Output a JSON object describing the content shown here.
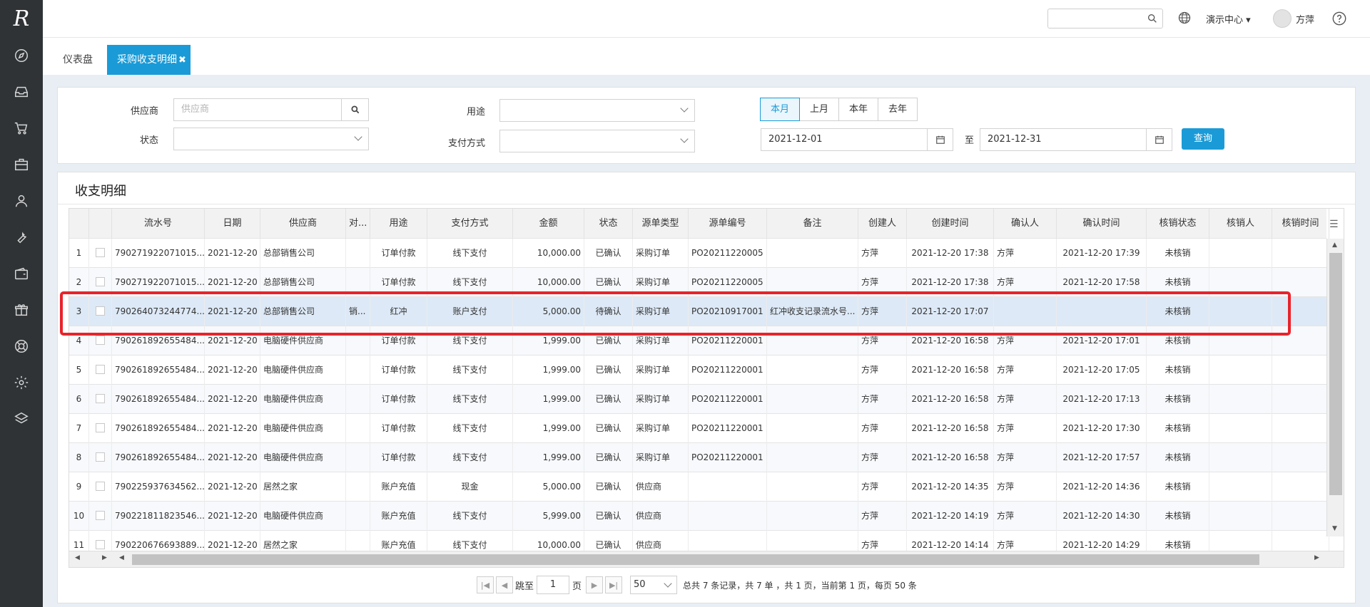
{
  "sidebar": {
    "logo": "R",
    "icons": [
      "compass-icon",
      "inbox-icon",
      "cart-icon",
      "briefcase-icon",
      "user-icon",
      "wrench-icon",
      "wallet-icon",
      "gift-icon",
      "lifebuoy-icon",
      "gear-icon",
      "layers-icon"
    ]
  },
  "topbar": {
    "search_placeholder": "",
    "demo_center": "演示中心",
    "user_name": "方萍"
  },
  "tabs": [
    {
      "label": "仪表盘"
    },
    {
      "label": "采购收支明细",
      "active": true
    }
  ],
  "filter": {
    "supplier_label": "供应商",
    "supplier_placeholder": "供应商",
    "status_label": "状态",
    "status_value": "",
    "purpose_label": "用途",
    "purpose_value": "",
    "pay_method_label": "支付方式",
    "pay_method_value": "",
    "periods": [
      "本月",
      "上月",
      "本年",
      "去年"
    ],
    "active_period": "本月",
    "date_from": "2021-12-01",
    "to_label": "至",
    "date_to": "2021-12-31",
    "query_label": "查询"
  },
  "grid": {
    "title": "收支明细",
    "columns": [
      "流水号",
      "日期",
      "供应商",
      "对...",
      "用途",
      "支付方式",
      "金额",
      "状态",
      "源单类型",
      "源单编号",
      "备注",
      "创建人",
      "创建时间",
      "确认人",
      "确认时间",
      "核销状态",
      "核销人",
      "核销时间"
    ],
    "rows": [
      {
        "no": "1",
        "serial": "790271922071015...",
        "date": "2021-12-20",
        "supplier": "总部销售公司",
        "counter": "",
        "purpose": "订单付款",
        "pay": "线下支付",
        "amount": "10,000.00",
        "status": "已确认",
        "src_type": "采购订单",
        "src_no": "PO20211220005",
        "remark": "",
        "creator": "方萍",
        "created": "2021-12-20 17:38",
        "confirmer": "方萍",
        "confirmed": "2021-12-20 17:39",
        "wo_status": "未核销"
      },
      {
        "no": "2",
        "serial": "790271922071015...",
        "date": "2021-12-20",
        "supplier": "总部销售公司",
        "counter": "",
        "purpose": "订单付款",
        "pay": "线下支付",
        "amount": "10,000.00",
        "status": "已确认",
        "src_type": "采购订单",
        "src_no": "PO20211220005",
        "remark": "",
        "creator": "方萍",
        "created": "2021-12-20 17:38",
        "confirmer": "方萍",
        "confirmed": "2021-12-20 17:58",
        "wo_status": "未核销"
      },
      {
        "no": "3",
        "serial": "790264073244774...",
        "date": "2021-12-20",
        "supplier": "总部销售公司",
        "counter": "销...",
        "purpose": "红冲",
        "pay": "账户支付",
        "amount": "5,000.00",
        "status": "待确认",
        "src_type": "采购订单",
        "src_no": "PO20210917001",
        "remark": "红冲收支记录流水号...",
        "creator": "方萍",
        "created": "2021-12-20 17:07",
        "confirmer": "",
        "confirmed": "",
        "wo_status": "未核销"
      },
      {
        "no": "4",
        "serial": "790261892655484...",
        "date": "2021-12-20",
        "supplier": "电脑硬件供应商",
        "counter": "",
        "purpose": "订单付款",
        "pay": "线下支付",
        "amount": "1,999.00",
        "status": "已确认",
        "src_type": "采购订单",
        "src_no": "PO20211220001",
        "remark": "",
        "creator": "方萍",
        "created": "2021-12-20 16:58",
        "confirmer": "方萍",
        "confirmed": "2021-12-20 17:01",
        "wo_status": "未核销"
      },
      {
        "no": "5",
        "serial": "790261892655484...",
        "date": "2021-12-20",
        "supplier": "电脑硬件供应商",
        "counter": "",
        "purpose": "订单付款",
        "pay": "线下支付",
        "amount": "1,999.00",
        "status": "已确认",
        "src_type": "采购订单",
        "src_no": "PO20211220001",
        "remark": "",
        "creator": "方萍",
        "created": "2021-12-20 16:58",
        "confirmer": "方萍",
        "confirmed": "2021-12-20 17:05",
        "wo_status": "未核销"
      },
      {
        "no": "6",
        "serial": "790261892655484...",
        "date": "2021-12-20",
        "supplier": "电脑硬件供应商",
        "counter": "",
        "purpose": "订单付款",
        "pay": "线下支付",
        "amount": "1,999.00",
        "status": "已确认",
        "src_type": "采购订单",
        "src_no": "PO20211220001",
        "remark": "",
        "creator": "方萍",
        "created": "2021-12-20 16:58",
        "confirmer": "方萍",
        "confirmed": "2021-12-20 17:13",
        "wo_status": "未核销"
      },
      {
        "no": "7",
        "serial": "790261892655484...",
        "date": "2021-12-20",
        "supplier": "电脑硬件供应商",
        "counter": "",
        "purpose": "订单付款",
        "pay": "线下支付",
        "amount": "1,999.00",
        "status": "已确认",
        "src_type": "采购订单",
        "src_no": "PO20211220001",
        "remark": "",
        "creator": "方萍",
        "created": "2021-12-20 16:58",
        "confirmer": "方萍",
        "confirmed": "2021-12-20 17:30",
        "wo_status": "未核销"
      },
      {
        "no": "8",
        "serial": "790261892655484...",
        "date": "2021-12-20",
        "supplier": "电脑硬件供应商",
        "counter": "",
        "purpose": "订单付款",
        "pay": "线下支付",
        "amount": "1,999.00",
        "status": "已确认",
        "src_type": "采购订单",
        "src_no": "PO20211220001",
        "remark": "",
        "creator": "方萍",
        "created": "2021-12-20 16:58",
        "confirmer": "方萍",
        "confirmed": "2021-12-20 17:57",
        "wo_status": "未核销"
      },
      {
        "no": "9",
        "serial": "790225937634562...",
        "date": "2021-12-20",
        "supplier": "居然之家",
        "counter": "",
        "purpose": "账户充值",
        "pay": "现金",
        "amount": "5,000.00",
        "status": "已确认",
        "src_type": "供应商",
        "src_no": "",
        "remark": "",
        "creator": "方萍",
        "created": "2021-12-20 14:35",
        "confirmer": "方萍",
        "confirmed": "2021-12-20 14:36",
        "wo_status": "未核销"
      },
      {
        "no": "10",
        "serial": "790221811823546...",
        "date": "2021-12-20",
        "supplier": "电脑硬件供应商",
        "counter": "",
        "purpose": "账户充值",
        "pay": "线下支付",
        "amount": "5,999.00",
        "status": "已确认",
        "src_type": "供应商",
        "src_no": "",
        "remark": "",
        "creator": "方萍",
        "created": "2021-12-20 14:19",
        "confirmer": "方萍",
        "confirmed": "2021-12-20 14:30",
        "wo_status": "未核销"
      },
      {
        "no": "11",
        "serial": "790220676693889...",
        "date": "2021-12-20",
        "supplier": "居然之家",
        "counter": "",
        "purpose": "账户充值",
        "pay": "线下支付",
        "amount": "10,000.00",
        "status": "已确认",
        "src_type": "供应商",
        "src_no": "",
        "remark": "",
        "creator": "方萍",
        "created": "2021-12-20 14:14",
        "confirmer": "方萍",
        "confirmed": "2021-12-20 14:29",
        "wo_status": "未核销"
      }
    ],
    "selected_row": 3
  },
  "pager": {
    "jump_label": "跳至",
    "page_value": "1",
    "page_unit": "页",
    "page_size": "50",
    "summary": "总共 7 条记录，共 7 单 ，共 1 页，当前第 1 页，每页 50 条"
  }
}
